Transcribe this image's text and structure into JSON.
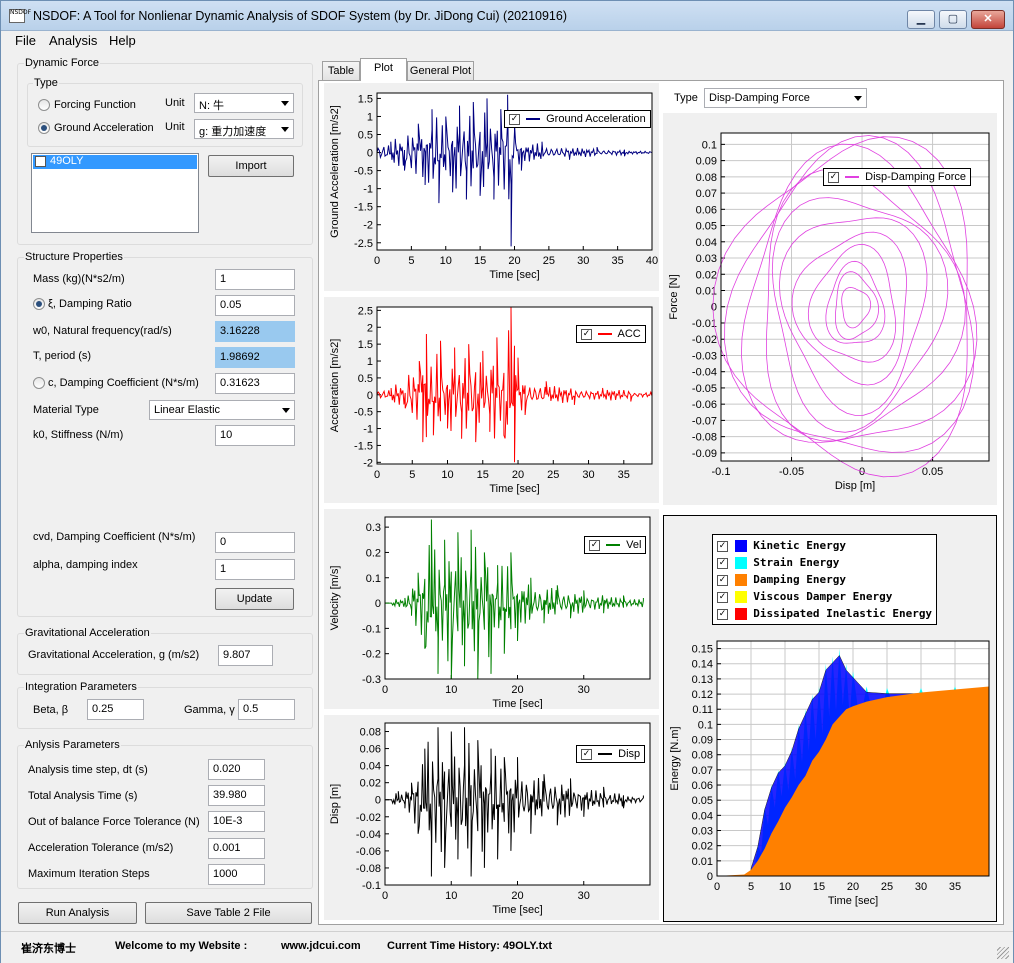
{
  "window": {
    "title": "NSDOF: A Tool for Nonlienar Dynamic Analysis of SDOF System (by Dr. JiDong Cui) (20210916)",
    "app_icon_text": "NSDOF",
    "minimize": "▁",
    "maximize": "▢",
    "close": "✕"
  },
  "menu": [
    "File",
    "Analysis",
    "Help"
  ],
  "dynamic_force": {
    "title": "Dynamic Force",
    "type_label": "Type",
    "forcing_function": "Forcing Function",
    "ground_acceleration": "Ground Acceleration",
    "unit_label": "Unit",
    "unit1": "N: 牛",
    "unit2": "g: 重力加速度",
    "list_item": "49OLY",
    "import_button": "Import"
  },
  "structure": {
    "title": "Structure Properties",
    "mass_label": "Mass (kg)(N*s2/m)",
    "mass": "1",
    "damping_ratio_label": "ξ, Damping Ratio",
    "damping_ratio": "0.05",
    "w0_label": "w0, Natural frequency(rad/s)",
    "w0": "3.16228",
    "period_label": "T, period (s)",
    "period": "1.98692",
    "damping_coef_label": "c, Damping Coefficient (N*s/m)",
    "damping_coef": "0.31623",
    "material_label": "Material Type",
    "material": "Linear Elastic",
    "stiffness_label": "k0, Stiffness (N/m)",
    "stiffness": "10",
    "cvd_label": "cvd, Damping Coefficient (N*s/m)",
    "cvd": "0",
    "alpha_label": "alpha, damping index",
    "alpha": "1",
    "update_button": "Update"
  },
  "gravity": {
    "title": "Gravitational Acceleration",
    "label": "Gravitational Acceleration, g (m/s2)",
    "value": "9.807"
  },
  "integration": {
    "title": "Integration Parameters",
    "beta_label": "Beta, β",
    "beta": "0.25",
    "gamma_label": "Gamma, γ",
    "gamma": "0.5"
  },
  "analysis": {
    "title": "Anlysis  Parameters",
    "dt_label": "Analysis time step, dt (s)",
    "dt": "0.020",
    "total_label": "Total Analysis Time (s)",
    "total": "39.980",
    "force_tol_label": "Out of balance Force Tolerance (N)",
    "force_tol": "10E-3",
    "acc_tol_label": "Acceleration Tolerance (m/s2)",
    "acc_tol": "0.001",
    "iter_label": "Maximum Iteration Steps",
    "iter": "1000"
  },
  "buttons": {
    "run": "Run Analysis",
    "save": "Save Table 2 File"
  },
  "tabs": [
    "Table",
    "Plot",
    "General Plot"
  ],
  "plot_type": {
    "label": "Type",
    "value": "Disp-Damping Force"
  },
  "status": {
    "author": "崔济东博士",
    "welcome": "Welcome to my Website :",
    "website": "www.jdcui.com",
    "history": "Current Time History: 49OLY.txt"
  },
  "chart_data": [
    {
      "type": "line",
      "ylabel": "Ground Acceleration [m/s2]",
      "xlabel": "Time [sec]",
      "legend": "Ground Acceleration",
      "color": "#000080",
      "xlim": [
        0,
        40
      ],
      "ylim": [
        -2.7,
        1.65
      ],
      "xticks": [
        0,
        5,
        10,
        15,
        20,
        25,
        30,
        35,
        40
      ],
      "yticks": [
        1.5,
        1,
        0.5,
        0,
        -0.5,
        -1,
        -1.5,
        -2,
        -2.5
      ],
      "ytick_labels": [
        "1.5",
        "1",
        "0.5",
        "0",
        "-0.5",
        "-1",
        "-1.5",
        "-2",
        "-2.5"
      ],
      "peak_times": [
        2,
        4,
        6,
        7,
        8,
        9,
        10,
        11,
        12,
        13,
        14,
        15,
        16,
        17,
        18,
        19,
        19.5,
        20,
        21,
        24,
        28,
        32,
        36,
        40
      ],
      "peak_values": [
        0.3,
        -0.5,
        0.8,
        -0.9,
        1.2,
        -1.4,
        1.0,
        -1.1,
        1.3,
        -1.3,
        1.4,
        -1.2,
        1.5,
        -1.3,
        1.2,
        1.6,
        -2.6,
        0.8,
        -0.5,
        0.3,
        -0.2,
        0.15,
        -0.1,
        0.05
      ]
    },
    {
      "type": "line",
      "ylabel": "Acceleration [m/s2]",
      "xlabel": "Time [sec]",
      "legend": "ACC",
      "color": "#ff0000",
      "xlim": [
        0,
        39
      ],
      "ylim": [
        -2.05,
        2.6
      ],
      "xticks": [
        0,
        5,
        10,
        15,
        20,
        25,
        30,
        35
      ],
      "yticks": [
        2.5,
        2,
        1.5,
        1,
        0.5,
        0,
        -0.5,
        -1,
        -1.5,
        -2
      ],
      "ytick_labels": [
        "2.5",
        "2",
        "1.5",
        "1",
        "0.5",
        "0",
        "-0.5",
        "-1",
        "-1.5",
        "-2"
      ],
      "peak_times": [
        2,
        4,
        6,
        6.5,
        7,
        8,
        9,
        10,
        11,
        12,
        13,
        14,
        15,
        16,
        17,
        18,
        19,
        19.5,
        20,
        21,
        24,
        28,
        32,
        36,
        39
      ],
      "peak_values": [
        0.2,
        -0.4,
        1.0,
        -1.4,
        1.8,
        -1.2,
        1.6,
        -1.0,
        1.4,
        -1.3,
        1.5,
        -1.4,
        1.3,
        -1.1,
        1.7,
        -1.2,
        2.6,
        -2.0,
        1.1,
        -0.6,
        0.4,
        -0.3,
        0.2,
        -0.2,
        0.1
      ]
    },
    {
      "type": "line",
      "ylabel": "Velocity [m/s]",
      "xlabel": "Time [sec]",
      "legend": "Vel",
      "color": "#008000",
      "xlim": [
        0,
        40
      ],
      "ylim": [
        -0.3,
        0.34
      ],
      "xticks": [
        0,
        10,
        20,
        30
      ],
      "yticks": [
        0.3,
        0.2,
        0.1,
        0,
        -0.1,
        -0.2,
        -0.3
      ],
      "ytick_labels": [
        "0.3",
        "0.2",
        "0.1",
        "0",
        "-0.1",
        "-0.2",
        "-0.3"
      ],
      "peak_times": [
        1,
        3,
        4,
        5,
        6,
        7,
        8,
        9,
        10,
        11,
        12,
        13,
        14,
        15,
        16,
        17,
        18,
        19,
        20,
        22,
        24,
        26,
        28,
        30,
        33,
        36,
        39
      ],
      "peak_values": [
        0,
        0.02,
        -0.05,
        0.12,
        -0.18,
        0.33,
        -0.28,
        0.25,
        -0.3,
        0.28,
        -0.25,
        0.29,
        -0.3,
        0.2,
        -0.28,
        0.15,
        -0.2,
        0.2,
        -0.15,
        0.1,
        -0.08,
        0.07,
        -0.06,
        0.05,
        -0.04,
        0.03,
        0.02
      ]
    },
    {
      "type": "line",
      "ylabel": "Disp [m]",
      "xlabel": "Time [sec]",
      "legend": "Disp",
      "color": "#000000",
      "xlim": [
        0,
        40
      ],
      "ylim": [
        -0.1,
        0.09
      ],
      "xticks": [
        0,
        10,
        20,
        30
      ],
      "yticks": [
        0.08,
        0.06,
        0.04,
        0.02,
        0,
        -0.02,
        -0.04,
        -0.06,
        -0.08,
        -0.1
      ],
      "ytick_labels": [
        "0.08",
        "0.06",
        "0.04",
        "0.02",
        "0",
        "-0.02",
        "-0.04",
        "-0.06",
        "-0.08",
        "-0.1"
      ],
      "peak_times": [
        1,
        2,
        3,
        4,
        5,
        6,
        7,
        8,
        9,
        10,
        11,
        12,
        13,
        14,
        15,
        16,
        17,
        18,
        19,
        20,
        22,
        24,
        26,
        28,
        30,
        33,
        36,
        39
      ],
      "peak_values": [
        0,
        0.01,
        -0.01,
        0.02,
        -0.04,
        0.06,
        -0.09,
        0.085,
        -0.08,
        0.08,
        -0.07,
        0.085,
        -0.09,
        0.07,
        -0.08,
        0.06,
        -0.07,
        0.05,
        -0.06,
        0.05,
        -0.04,
        0.03,
        -0.03,
        0.025,
        -0.02,
        0.015,
        -0.01,
        0.005
      ]
    },
    {
      "type": "scatter",
      "ylabel": "Force [N]",
      "xlabel": "Disp [m]",
      "legend": "Disp-Damping Force",
      "color": "#e040e0",
      "xlim": [
        -0.1,
        0.09
      ],
      "ylim": [
        -0.095,
        0.107
      ],
      "xticks": [
        -0.1,
        -0.05,
        0,
        0.05
      ],
      "xtick_labels": [
        "-0.1",
        "-0.05",
        "0",
        "0.05"
      ],
      "yticks": [
        0.1,
        0.09,
        0.08,
        0.07,
        0.06,
        0.05,
        0.04,
        0.03,
        0.02,
        0.01,
        0,
        -0.01,
        -0.02,
        -0.03,
        -0.04,
        -0.05,
        -0.06,
        -0.07,
        -0.08,
        -0.09
      ],
      "ytick_labels": [
        "0.1",
        "0.09",
        "0.08",
        "0.07",
        "0.06",
        "0.05",
        "0.04",
        "0.03",
        "0.02",
        "0.01",
        "0",
        "-0.01",
        "-0.02",
        "-0.03",
        "-0.04",
        "-0.05",
        "-0.06",
        "-0.07",
        "-0.08",
        "-0.09"
      ],
      "loop_amplitudes_disp": [
        0.09,
        0.085,
        0.08,
        0.07,
        0.06,
        0.05,
        0.04,
        0.03,
        0.02,
        0.015,
        0.01
      ],
      "loop_amplitudes_force": [
        0.1,
        0.095,
        0.09,
        0.08,
        0.07,
        0.06,
        0.045,
        0.035,
        0.025,
        0.02,
        0.012
      ]
    },
    {
      "type": "area",
      "ylabel": "Energy [N.m]",
      "xlabel": "Time [sec]",
      "xlim": [
        0,
        40
      ],
      "ylim": [
        0,
        0.155
      ],
      "xticks": [
        0,
        5,
        10,
        15,
        20,
        25,
        30,
        35
      ],
      "yticks": [
        0,
        0.01,
        0.02,
        0.03,
        0.04,
        0.05,
        0.06,
        0.07,
        0.08,
        0.09,
        0.1,
        0.11,
        0.12,
        0.13,
        0.14,
        0.15
      ],
      "ytick_labels": [
        "0",
        "0.01",
        "0.02",
        "0.03",
        "0.04",
        "0.05",
        "0.06",
        "0.07",
        "0.08",
        "0.09",
        "0.1",
        "0.11",
        "0.12",
        "0.13",
        "0.14",
        "0.15"
      ],
      "series": [
        {
          "name": "Kinetic Energy",
          "color": "#0000ff"
        },
        {
          "name": "Strain Energy",
          "color": "#00ffff"
        },
        {
          "name": "Damping Energy",
          "color": "#ff8000"
        },
        {
          "name": "Viscous Damper Energy",
          "color": "#ffff00"
        },
        {
          "name": "Dissipated Inelastic Energy",
          "color": "#ff0000"
        }
      ],
      "damping_times": [
        0,
        4,
        5,
        6,
        7,
        8,
        9,
        10,
        11,
        12,
        13,
        14,
        15,
        16,
        17,
        18,
        19,
        20,
        22,
        25,
        30,
        35,
        40
      ],
      "damping_values": [
        0,
        0.001,
        0.004,
        0.01,
        0.018,
        0.028,
        0.036,
        0.045,
        0.052,
        0.06,
        0.066,
        0.076,
        0.082,
        0.09,
        0.1,
        0.105,
        0.11,
        0.112,
        0.115,
        0.118,
        0.121,
        0.123,
        0.125
      ],
      "total_peak_times": [
        5,
        6,
        7,
        8,
        9,
        10,
        11,
        12,
        13,
        14,
        15,
        16,
        17,
        18,
        19,
        20,
        22,
        25,
        30,
        35,
        40
      ],
      "total_peak_values": [
        0.005,
        0.02,
        0.045,
        0.06,
        0.07,
        0.075,
        0.085,
        0.1,
        0.11,
        0.12,
        0.125,
        0.14,
        0.145,
        0.15,
        0.14,
        0.135,
        0.125,
        0.124,
        0.124,
        0.125,
        0.126
      ]
    }
  ]
}
